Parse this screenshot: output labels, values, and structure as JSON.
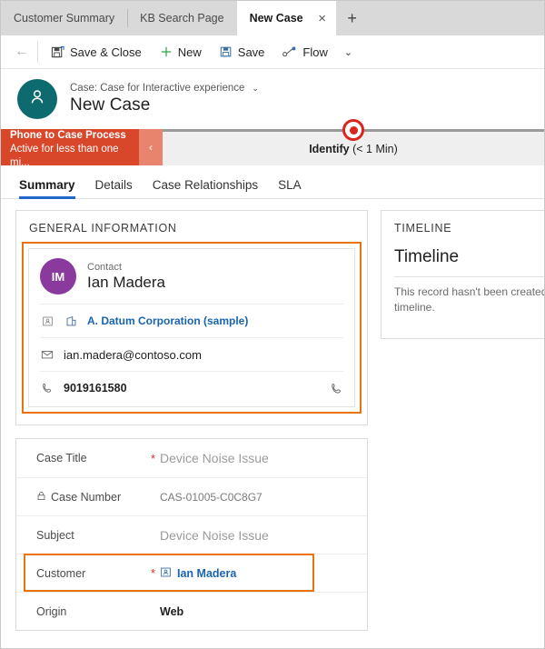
{
  "browser_tabs": {
    "tabs": [
      {
        "label": "Customer Summary",
        "active": false
      },
      {
        "label": "KB Search Page",
        "active": false
      },
      {
        "label": "New Case",
        "active": true
      }
    ],
    "close_icon": "×",
    "new_tab_icon": "+"
  },
  "command_bar": {
    "back_icon": "←",
    "buttons": [
      {
        "label": "Save & Close",
        "icon": "save-and-close-icon"
      },
      {
        "label": "New",
        "icon": "plus-icon"
      },
      {
        "label": "Save",
        "icon": "save-icon"
      },
      {
        "label": "Flow",
        "icon": "flow-icon"
      }
    ],
    "chevron_icon": "⌄"
  },
  "record_header": {
    "avatar_initial_icon": "person-icon",
    "avatar_color": "#0d6a6e",
    "subtitle": "Case: Case for Interactive experience",
    "subtitle_chevron": "⌄",
    "title": "New Case"
  },
  "process_flow": {
    "name": "Phone to Case Process",
    "status": "Active for less than one mi...",
    "collapse_icon": "‹",
    "banner_color": "#d9472b",
    "stage_label": "Identify",
    "stage_duration": "(< 1 Min)",
    "marker_color": "#d9251d"
  },
  "form_tabs": [
    {
      "label": "Summary",
      "active": true
    },
    {
      "label": "Details",
      "active": false
    },
    {
      "label": "Case Relationships",
      "active": false
    },
    {
      "label": "SLA",
      "active": false
    }
  ],
  "general_information": {
    "section_header": "GENERAL INFORMATION",
    "highlight_color": "#e8730c",
    "quick_view": {
      "avatar_initials": "IM",
      "avatar_color": "#893a9c",
      "entity_label": "Contact",
      "contact_name": "Ian Madera",
      "account": {
        "contact_icon": "contact-card-icon",
        "account_icon": "account-icon",
        "name": "A. Datum Corporation (sample)"
      },
      "email": {
        "icon": "envelope-icon",
        "value": "ian.madera@contoso.com"
      },
      "phone": {
        "icon": "phone-icon",
        "value": "9019161580",
        "call_icon": "phone-call-icon"
      }
    }
  },
  "timeline": {
    "section_header": "TIMELINE",
    "title": "Timeline",
    "empty_message_line1": "This record hasn't been created yet.",
    "empty_message_line2": "timeline."
  },
  "case_fields": {
    "highlight_color": "#e8730c",
    "rows": [
      {
        "label": "Case Title",
        "required": true,
        "value": "Device Noise Issue",
        "style": "placeholder",
        "locked": false
      },
      {
        "label": "Case Number",
        "required": false,
        "value": "CAS-01005-C0C8G7",
        "style": "mono",
        "locked": true,
        "lock_icon": "lock-icon"
      },
      {
        "label": "Subject",
        "required": false,
        "value": "Device Noise Issue",
        "style": "placeholder",
        "locked": false
      },
      {
        "label": "Customer",
        "required": true,
        "value": "Ian Madera",
        "style": "link",
        "locked": false,
        "value_icon": "contact-card-icon",
        "highlighted": true
      },
      {
        "label": "Origin",
        "required": false,
        "value": "Web",
        "style": "strong",
        "locked": false
      }
    ]
  }
}
